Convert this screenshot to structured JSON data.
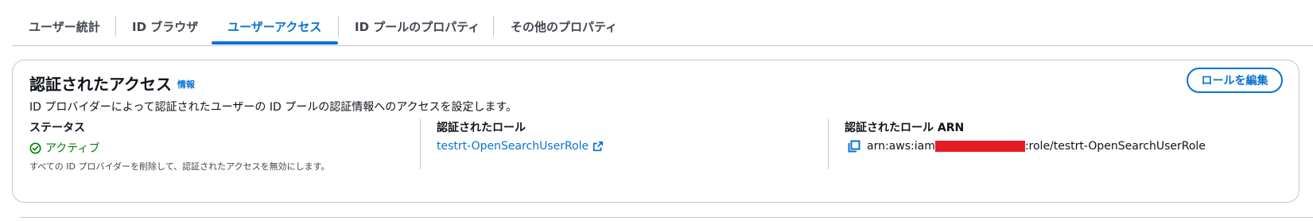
{
  "tabs": [
    {
      "label": "ユーザー統計"
    },
    {
      "label": "ID ブラウザ"
    },
    {
      "label": "ユーザーアクセス",
      "active": true
    },
    {
      "label": "ID プールのプロパティ"
    },
    {
      "label": "その他のプロパティ"
    }
  ],
  "section": {
    "title": "認証されたアクセス",
    "info_link": "情報",
    "description": "ID プロバイダーによって認証されたユーザーの ID プールの認証情報へのアクセスを設定します。",
    "edit_button": "ロールを編集",
    "status": {
      "label": "ステータス",
      "value": "アクティブ",
      "note": "すべての ID プロバイダーを削除して、認証されたアクセスを無効にします。"
    },
    "role": {
      "label": "認証されたロール",
      "value": "testrt-OpenSearchUserRole"
    },
    "role_arn": {
      "label": "認証されたロール ARN",
      "prefix": "arn:aws:iam",
      "suffix": ":role/testrt-OpenSearchUserRole"
    }
  },
  "colors": {
    "accent": "#0972d3",
    "success": "#037f0c",
    "redaction": "#e51c23",
    "border": "#c6c6cd"
  },
  "icons": [
    "success-circle-icon",
    "external-link-icon",
    "copy-icon"
  ]
}
